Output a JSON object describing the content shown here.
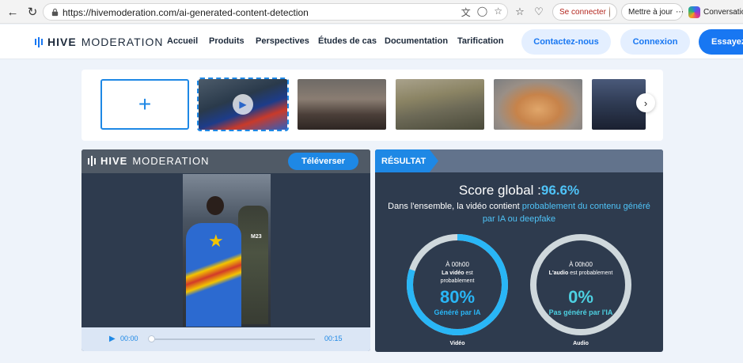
{
  "browser": {
    "url": "https://hivemoderation.com/ai-generated-content-detection",
    "sign_in_label": "Se connecter",
    "update_label": "Mettre à jour",
    "copilot_label": "Conversation"
  },
  "site": {
    "brand_bold": "HIVE",
    "brand_light": "MODERATION",
    "nav": [
      "Accueil",
      "Produits",
      "Perspectives",
      "Études de cas",
      "Documentation",
      "Tarification"
    ],
    "contact_label": "Contactez-nous",
    "login_label": "Connexion",
    "try_label": "Essayez",
    "accent": "#1877f2"
  },
  "thumbnails": {
    "upload_symbol": "+",
    "items": [
      "flag-video",
      "landscape",
      "painting",
      "cat",
      "press-room"
    ],
    "selected_index": 0
  },
  "video_panel": {
    "brand_bold": "HIVE",
    "brand_light": "MODERATION",
    "upload_label": "Téléverser",
    "current_time": "00:00",
    "duration": "00:15",
    "progress": 0,
    "overlay_text": "M23"
  },
  "result": {
    "tag": "RÉSULTAT",
    "score_label": "Score global :",
    "score_value": "96.6%",
    "desc_prefix": "Dans l'ensemble, la vidéo contient ",
    "desc_highlight": "probablement du contenu généré par IA ou deepfake",
    "video": {
      "time": "À 00h00",
      "line_bold": "La vidéo",
      "line_rest": " est",
      "line2": "probablement",
      "percent": "80%",
      "percent_value": 80,
      "verdict": "Généré par IA",
      "caption": "Vidéo",
      "color": "#29b6f6"
    },
    "audio": {
      "time": "À 00h00",
      "line_bold": "L'audio",
      "line_rest": " est probablement",
      "percent": "0%",
      "percent_value": 0,
      "verdict": "Pas généré par l'IA",
      "caption": "Audio",
      "color": "#4dd0e1"
    }
  }
}
